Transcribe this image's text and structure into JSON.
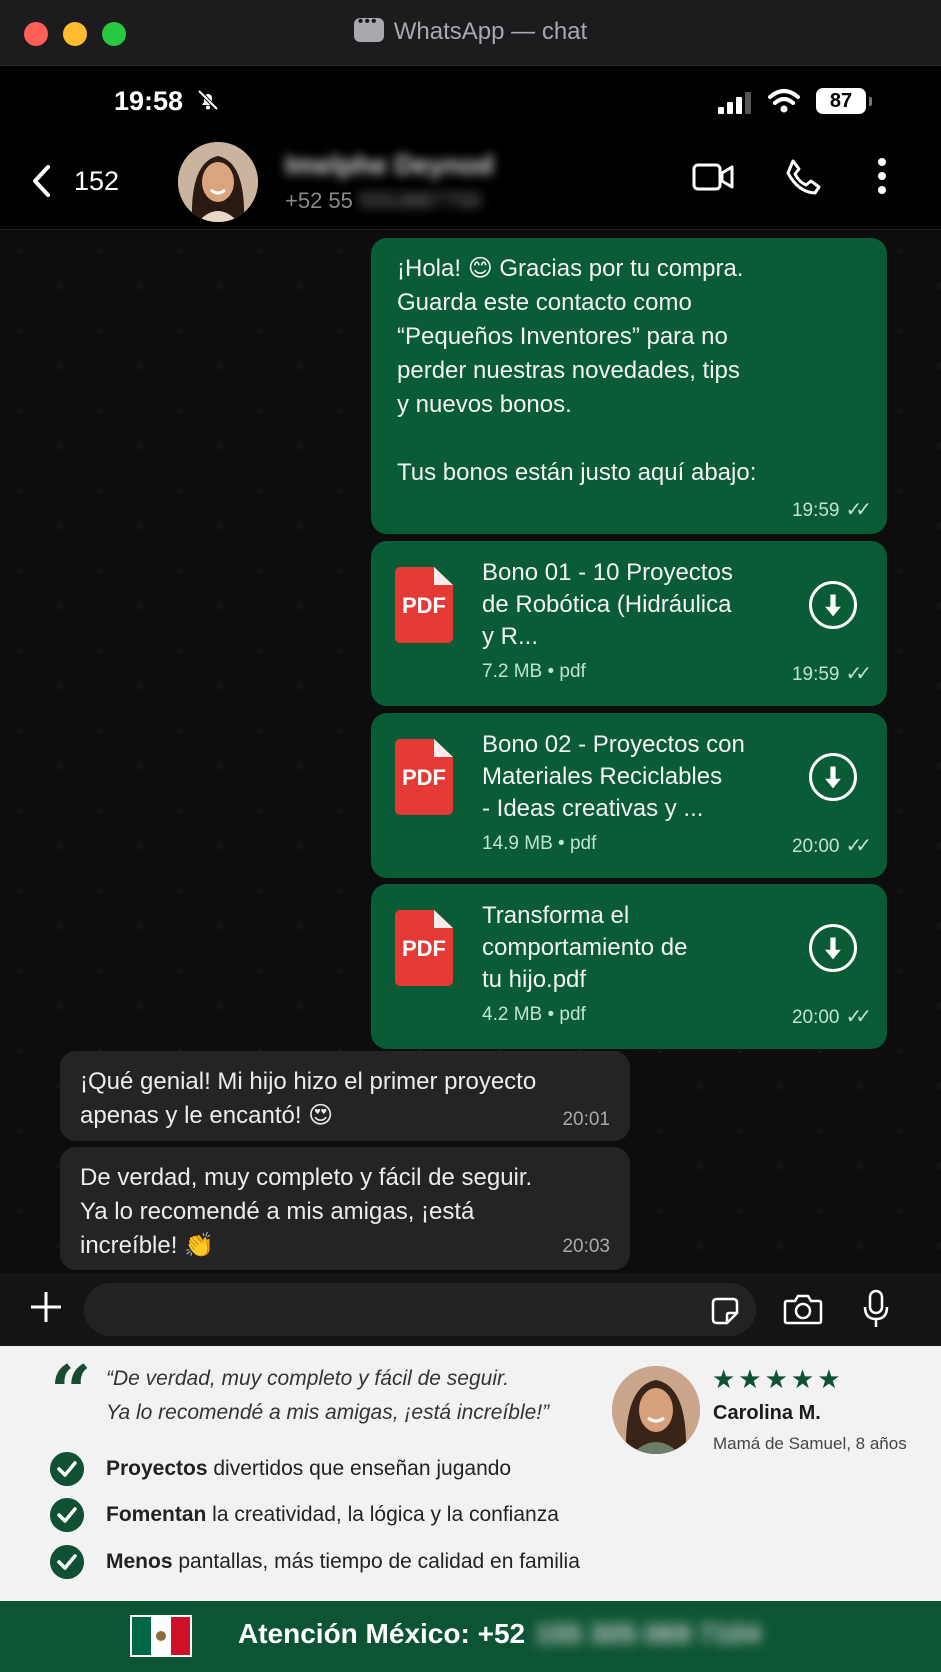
{
  "window": {
    "title": "WhatsApp — chat"
  },
  "status_bar": {
    "time": "19:58",
    "battery": "87"
  },
  "header": {
    "back_count": "152",
    "contact_name": "Imelphe Deynod",
    "phone_prefix": "+52 55",
    "phone_rest": "5553887700"
  },
  "messages": {
    "m1": {
      "text": "¡Hola! 😊 Gracias por tu compra.\nGuarda este contacto como\n“Pequeños Inventores” para no\nperder nuestras novedades, tips\ny nuevos bonos.\n\nTus bonos están justo aquí abajo:",
      "time": "19:59",
      "ticks": "✓✓"
    },
    "doc1": {
      "title": "Bono 01 - 10 Proyectos\nde Robótica (Hidráulica\ny R...",
      "meta": "7.2 MB • pdf",
      "time": "19:59",
      "ticks": "✓✓",
      "icon_label": "PDF"
    },
    "doc2": {
      "title": "Bono 02 - Proyectos con\nMateriales Reciclables\n- Ideas creativas y ...",
      "meta": "14.9 MB • pdf",
      "time": "20:00",
      "ticks": "✓✓",
      "icon_label": "PDF"
    },
    "doc3": {
      "title": "Transforma el\ncomportamiento de\ntu hijo.pdf",
      "meta": "4.2 MB • pdf",
      "time": "20:00",
      "ticks": "✓✓",
      "icon_label": "PDF"
    },
    "in1": {
      "text": "¡Qué genial! Mi hijo hizo el primer proyecto\napenas y le encantó! 😍",
      "time": "20:01"
    },
    "in2": {
      "text": "De verdad, muy completo y fácil de seguir.\nYa lo recomendé a mis amigas, ¡está\nincreíble! 👏",
      "time": "20:03"
    }
  },
  "compose": {
    "placeholder": ""
  },
  "testimonial": {
    "quote_mark": "“",
    "quote": "“De verdad, muy completo y fácil de seguir.\nYa lo recomendé a mis amigas, ¡está increíble!”",
    "stars": "★★★★★",
    "rating": 5,
    "name": "Carolina M.",
    "role": "Mamá de Samuel, 8 años",
    "bullets": [
      {
        "bold": "Proyectos",
        "rest": " divertidos que enseñan jugando"
      },
      {
        "bold": "Fomentan",
        "rest": " la creatividad, la lógica y la confianza"
      },
      {
        "bold": "Menos",
        "rest": " pantallas, más tiempo de calidad en familia"
      }
    ]
  },
  "footer": {
    "label": "Atención México: +52",
    "number": "155 305 069 7104"
  },
  "colors": {
    "bubble_out": "#0a5c36",
    "bubble_in": "#242424",
    "brand_green": "#0c5433",
    "pdf_red": "#e53935"
  }
}
